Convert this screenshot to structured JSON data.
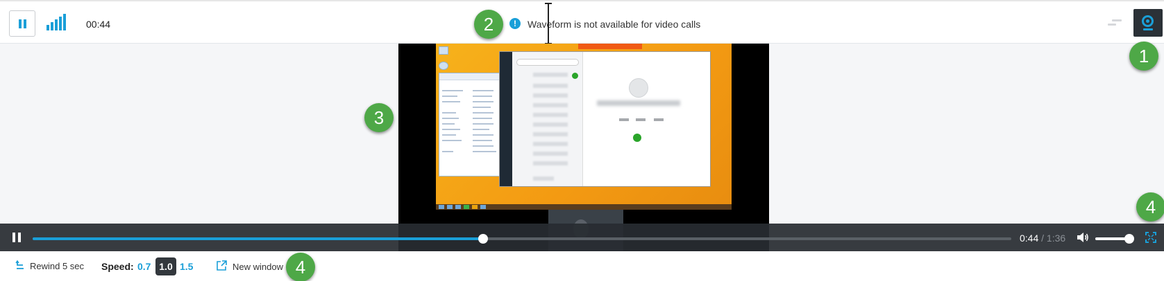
{
  "toolbar": {
    "elapsed_time": "00:44",
    "info_icon": "info-icon",
    "waveform_message": "Waveform is not available for video calls"
  },
  "player": {
    "current_time": "0:44",
    "separator": "/",
    "duration": "1:36",
    "progress_fraction": 0.46,
    "volume_fraction": 0.95
  },
  "bottom": {
    "rewind_label": "Rewind 5 sec",
    "speed_label": "Speed:",
    "speed_options": [
      "0.7",
      "1.0",
      "1.5"
    ],
    "speed_selected": "1.0",
    "new_window_label": "New window"
  },
  "callouts": [
    "1",
    "2",
    "3",
    "4",
    "4"
  ],
  "colors": {
    "accent": "#1a9fd8",
    "callout": "#4ea847",
    "controls_bg": "#282c32"
  }
}
